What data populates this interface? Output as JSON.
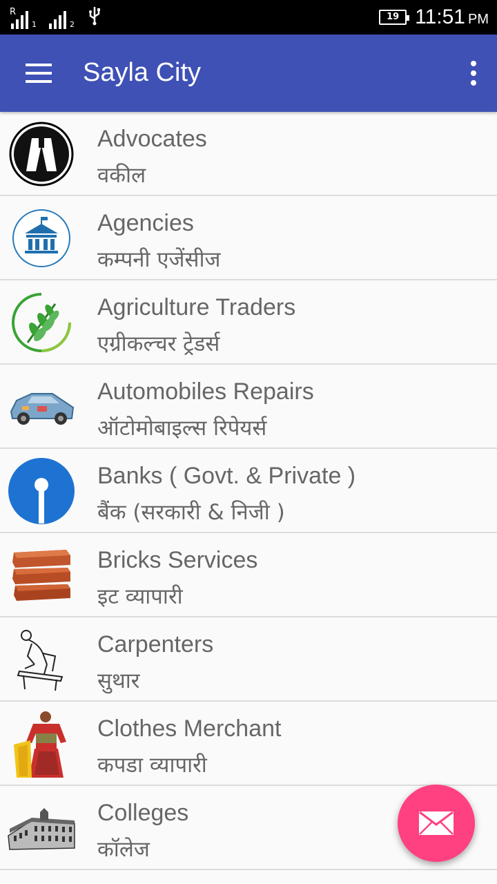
{
  "status_bar": {
    "sim1_label": "1",
    "sim2_label": "2",
    "roaming_label": "R",
    "battery_level": "19",
    "time": "11:51",
    "ampm": "PM"
  },
  "toolbar": {
    "title": "Sayla City",
    "menu_icon": "hamburger-menu-icon",
    "overflow_icon": "more-vert-icon",
    "color": "#3f51b5"
  },
  "categories": [
    {
      "name": "Advocates",
      "hindi": "वकील",
      "icon": "advocate-icon"
    },
    {
      "name": "Agencies",
      "hindi": "कम्पनी एजेंसीज",
      "icon": "building-icon"
    },
    {
      "name": "Agriculture Traders",
      "hindi": "एग्रीकल्चर ट्रेडर्स",
      "icon": "leaf-icon"
    },
    {
      "name": "Automobiles Repairs",
      "hindi": "ऑटोमोबाइल्स रिपेयर्स",
      "icon": "car-icon"
    },
    {
      "name": "Banks ( Govt. & Private )",
      "hindi": "बैंक (सरकारी & निजी )",
      "icon": "bank-icon"
    },
    {
      "name": "Bricks Services",
      "hindi": "इट व्यापारी",
      "icon": "bricks-icon"
    },
    {
      "name": "Carpenters",
      "hindi": "सुथार",
      "icon": "carpenter-icon"
    },
    {
      "name": "Clothes Merchant",
      "hindi": "कपडा व्यापारी",
      "icon": "clothes-icon"
    },
    {
      "name": "Colleges",
      "hindi": "कॉलेज",
      "icon": "college-icon"
    }
  ],
  "fab": {
    "icon": "mail-icon",
    "color": "#ff4081"
  }
}
